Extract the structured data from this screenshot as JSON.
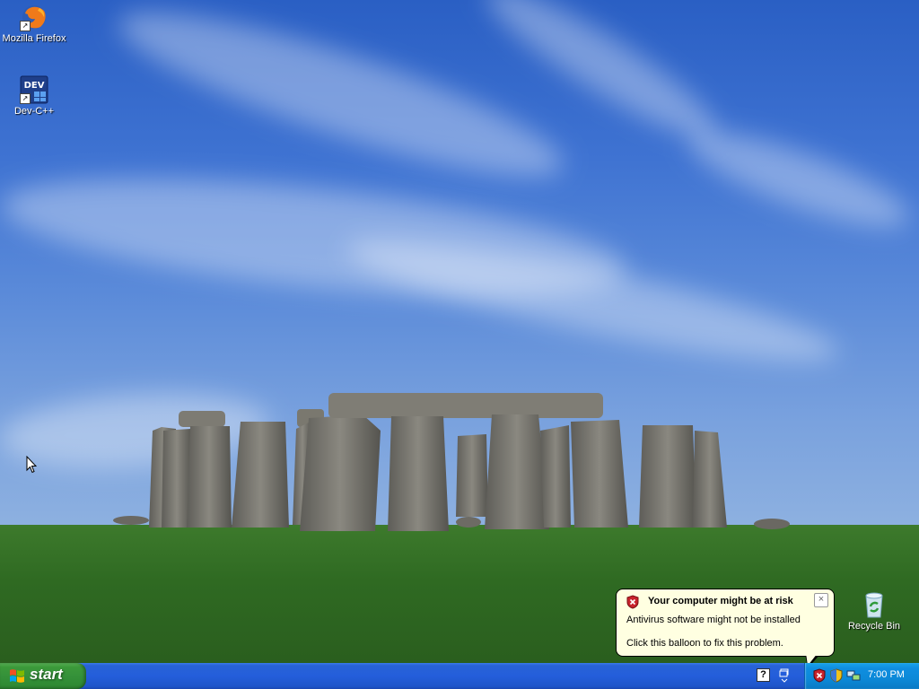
{
  "desktop": {
    "icons": [
      {
        "label": "Mozilla Firefox",
        "icon": "firefox-icon"
      },
      {
        "label": "Dev-C++",
        "icon": "devcpp-icon"
      },
      {
        "label": "Recycle Bin",
        "icon": "recycle-bin-icon"
      }
    ]
  },
  "balloon": {
    "title": "Your computer might be at risk",
    "line1": "Antivirus software might not be installed",
    "line2": "Click this balloon to fix this problem.",
    "close_label": "×",
    "icon": "security-shield-icon"
  },
  "taskbar": {
    "start_label": "start",
    "clock": "7:00 PM",
    "help_label": "?",
    "tray_icons": [
      "security-alert-icon",
      "windows-security-icon",
      "network-icon"
    ]
  },
  "colors": {
    "taskbar": "#245edb",
    "start_button": "#35913a",
    "tray": "#0c89d8",
    "balloon_bg": "#ffffe1"
  }
}
